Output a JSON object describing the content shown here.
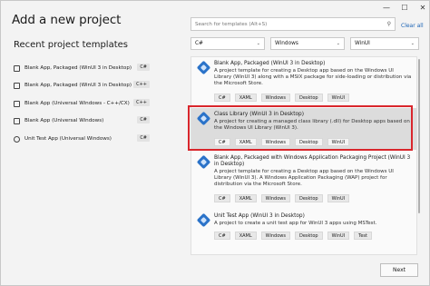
{
  "window": {
    "title": "Add a new project",
    "minimize": "—",
    "maximize": "☐",
    "close": "✕"
  },
  "recent": {
    "title": "Recent project templates",
    "items": [
      {
        "label": "Blank App, Packaged (WinUI 3 in Desktop)",
        "lang": "C#",
        "icon": "winui-app-icon"
      },
      {
        "label": "Blank App, Packaged (WinUI 3 in Desktop)",
        "lang": "C++",
        "icon": "winui-app-icon"
      },
      {
        "label": "Blank App (Universal Windows - C++/CX)",
        "lang": "C++",
        "icon": "uwp-app-icon"
      },
      {
        "label": "Blank App (Universal Windows)",
        "lang": "C#",
        "icon": "uwp-app-icon"
      },
      {
        "label": "Unit Test App (Universal Windows)",
        "lang": "C#",
        "icon": "test-app-icon"
      }
    ]
  },
  "search": {
    "placeholder": "Search for templates (Alt+S)",
    "clear_all": "Clear all"
  },
  "filters": {
    "language": "C#",
    "platform": "Windows",
    "project_type": "WinUI"
  },
  "templates": [
    {
      "name": "Blank App, Packaged (WinUI 3 in Desktop)",
      "description": "A project template for creating a Desktop app based on the Windows UI Library (WinUI 3) along with a MSIX package for side-loading or distribution via the Microsoft Store.",
      "tags": [
        "C#",
        "XAML",
        "Windows",
        "Desktop",
        "WinUI"
      ]
    },
    {
      "name": "Class Library (WinUI 3 in Desktop)",
      "description": "A project for creating a managed class library (.dll) for Desktop apps based on the Windows UI Library (WinUI 3).",
      "tags": [
        "C#",
        "XAML",
        "Windows",
        "Desktop",
        "WinUI"
      ]
    },
    {
      "name": "Blank App, Packaged with Windows Application Packaging Project (WinUI 3 in Desktop)",
      "description": "A project template for creating a Desktop app based on the Windows UI Library (WinUI 3). A Windows Application Packaging (WAP) project for distribution via the Microsoft Store.",
      "tags": [
        "C#",
        "XAML",
        "Windows",
        "Desktop",
        "WinUI"
      ]
    },
    {
      "name": "Unit Test App (WinUI 3 in Desktop)",
      "description": "A project to create a unit test app for WinUI 3 apps using MSTest.",
      "tags": [
        "C#",
        "XAML",
        "Windows",
        "Desktop",
        "WinUI",
        "Test"
      ]
    }
  ],
  "footer": {
    "next_label": "Next"
  },
  "colors": {
    "highlight": "#d9262c",
    "accent": "#2b73c9",
    "link": "#1a63b5"
  }
}
